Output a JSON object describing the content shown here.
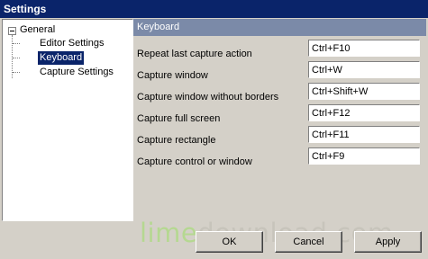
{
  "window": {
    "title": "Settings"
  },
  "tree": {
    "root": "General",
    "children": [
      "Editor Settings",
      "Keyboard",
      "Capture Settings"
    ],
    "selected": "Keyboard"
  },
  "panel": {
    "title": "Keyboard",
    "rows": [
      {
        "label": "Repeat last capture action",
        "value": "Ctrl+F10"
      },
      {
        "label": "Capture window",
        "value": "Ctrl+W"
      },
      {
        "label": "Capture window without borders",
        "value": "Ctrl+Shift+W"
      },
      {
        "label": "Capture full screen",
        "value": "Ctrl+F12"
      },
      {
        "label": "Capture rectangle",
        "value": "Ctrl+F11"
      },
      {
        "label": "Capture control or window",
        "value": "Ctrl+F9"
      }
    ]
  },
  "buttons": {
    "ok": "OK",
    "cancel": "Cancel",
    "apply": "Apply"
  },
  "watermark": {
    "part1": "lime",
    "part2": "download.com"
  }
}
